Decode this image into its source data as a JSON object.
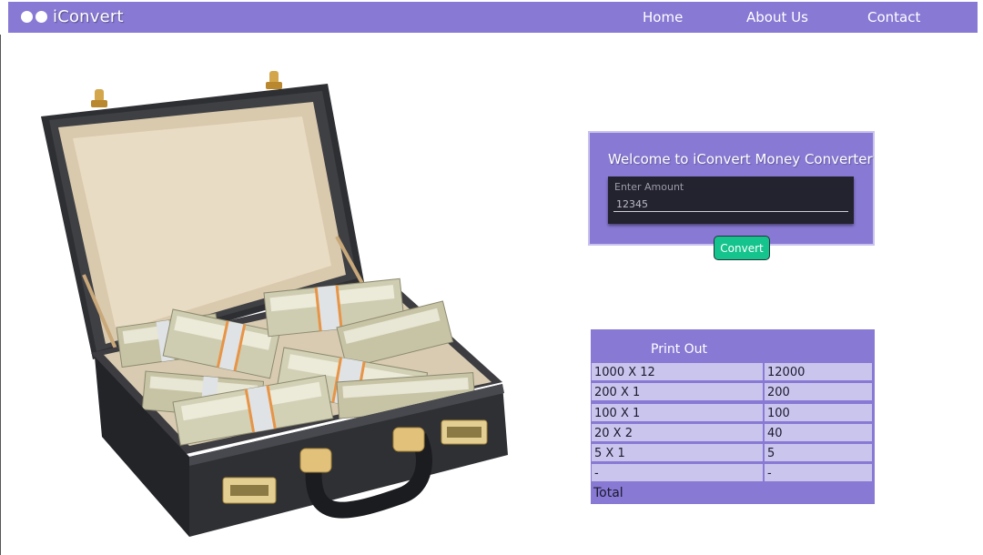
{
  "nav": {
    "brand": "iConvert",
    "links": [
      "Home",
      "About Us",
      "Contact"
    ]
  },
  "converter": {
    "title": "Welcome to iConvert Money Converter",
    "amount_label": "Enter Amount",
    "amount_value": "12345",
    "button_label": "Convert"
  },
  "printout": {
    "title": "Print Out",
    "rows": [
      [
        "1000 X 12",
        "12000"
      ],
      [
        "200 X 1",
        "200"
      ],
      [
        "100 X 1",
        "100"
      ],
      [
        "20 X 2",
        "40"
      ],
      [
        "5 X 1",
        "5"
      ],
      [
        "-",
        "-"
      ]
    ],
    "total_label": "Total"
  },
  "colors": {
    "accent": "#8879d4",
    "table_cell": "#cac5ed",
    "button": "#14c48c",
    "input_bg": "#23222f"
  },
  "icons": [
    "logo-dots-icon",
    "briefcase-money-illustration"
  ]
}
